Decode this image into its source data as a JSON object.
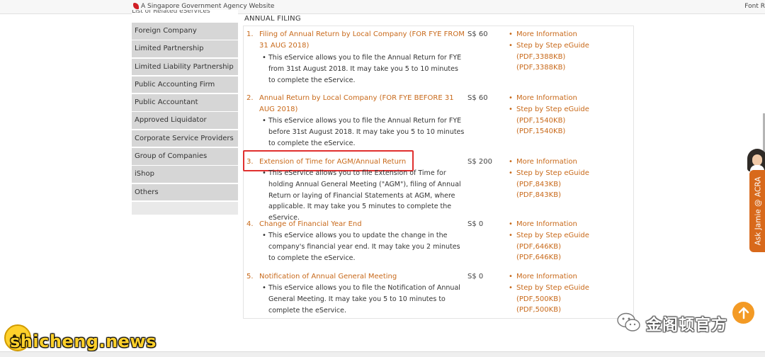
{
  "header": {
    "gov_text": "A Singapore Government Agency Website",
    "font_resize": "Font R"
  },
  "sidebar": {
    "cut_item": "List of Related eServices",
    "items": [
      {
        "label": "Foreign Company"
      },
      {
        "label": "Limited Partnership"
      },
      {
        "label": "Limited Liability Partnership"
      },
      {
        "label": "Public Accounting Firm"
      },
      {
        "label": "Public Accountant"
      },
      {
        "label": "Approved Liquidator"
      },
      {
        "label": "Corporate Service Providers"
      },
      {
        "label": "Group of Companies"
      },
      {
        "label": "iShop"
      },
      {
        "label": "Others"
      }
    ]
  },
  "section": {
    "title": "ANNUAL FILING"
  },
  "services": [
    {
      "num": "1.",
      "title": "Filing of Annual Return by Local Company (FOR FYE FROM 31 AUG 2018)",
      "desc": "This eService allows you to file the Annual Return for FYE from 31st August 2018. It may take you 5 to 10 minutes to complete the eService.",
      "fee": "S$ 60",
      "more": "More Information",
      "guide": "Step by Step eGuide (PDF,3388KB)",
      "guide_cont": "(PDF,3388KB)"
    },
    {
      "num": "2.",
      "title": "Annual Return by Local Company (FOR FYE BEFORE 31 AUG 2018)",
      "desc": "This eService allows you to file the Annual Return for FYE before 31st August 2018. It may take you 5 to 10 minutes to complete the eService.",
      "fee": "S$ 60",
      "more": "More Information",
      "guide": "Step by Step eGuide (PDF,1540KB)",
      "guide_cont": "(PDF,1540KB)"
    },
    {
      "num": "3.",
      "title": "Extension of Time for AGM/Annual Return",
      "desc": "This eService allows you to file Extension of Time for holding Annual General Meeting (\"AGM\"), filing of Annual Return or laying of Financial Statements at AGM, where applicable. It may take you 5 minutes to complete the eService.",
      "fee": "S$ 200",
      "more": "More Information",
      "guide": "Step by Step eGuide (PDF,843KB)",
      "guide_cont": "(PDF,843KB)"
    },
    {
      "num": "4.",
      "title": "Change of Financial Year End",
      "desc": "This eService allows you to update the change in the company's financial year end. It may take you 2 minutes to complete the eService.",
      "fee": "S$ 0",
      "more": "More Information",
      "guide": "Step by Step eGuide (PDF,646KB)",
      "guide_cont": "(PDF,646KB)"
    },
    {
      "num": "5.",
      "title": "Notification of Annual General Meeting",
      "desc": "This eService allows you to file the Notification of Annual General Meeting. It may take you 5 to 10 minutes to complete the eService.",
      "fee": "S$ 0",
      "more": "More Information",
      "guide": "Step by Step eGuide (PDF,500KB)",
      "guide_cont": "(PDF,500KB)"
    }
  ],
  "widgets": {
    "ask_jamie": "Ask Jamie @ ACRA",
    "watermark_cn": "金阁顿官方",
    "watermark_site": "shicheng.news"
  },
  "colors": {
    "accent_link": "#c8691a",
    "sidebar_bg": "#d6d6d6",
    "highlight": "#e0302f",
    "jamie_tab": "#d8691b",
    "back_to_top": "#f39a25"
  },
  "icons": {
    "gov_logo": "lion-head-icon",
    "back_to_top": "arrow-up-icon",
    "watermark": "wechat-icon",
    "site_logo": "smiley-icon"
  }
}
